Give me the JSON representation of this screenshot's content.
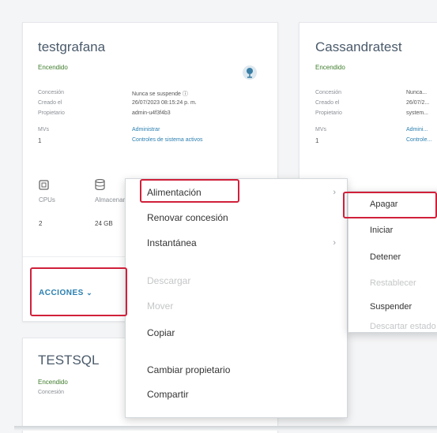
{
  "cards": {
    "testgrafana": {
      "title": "testgrafana",
      "status": "Encendido",
      "meta": [
        {
          "label": "Concesión",
          "value": "Nunca se suspende ⓘ"
        },
        {
          "label": "Creado el",
          "value": "26/07/2023 08:15:24 p. m."
        },
        {
          "label": "Propietario",
          "value": "admin-u4f3f4b3"
        },
        {
          "label": "MVs",
          "value": "Administrar"
        },
        {
          "label": "1",
          "value": "Controles de sistema activos"
        }
      ],
      "stats": [
        {
          "label": "CPUs",
          "value": "2"
        },
        {
          "label": "Almacenamiento",
          "value": "24 GB"
        }
      ],
      "actions_label": "ACCIONES"
    },
    "cassandratest": {
      "title": "Cassandratest",
      "status": "Encendido",
      "meta": [
        {
          "label": "Concesión",
          "value": "Nunca..."
        },
        {
          "label": "Creado el",
          "value": "26/07/2..."
        },
        {
          "label": "Propietario",
          "value": "system..."
        },
        {
          "label": "MVs",
          "value": "Admini..."
        },
        {
          "label": "1",
          "value": "Controle..."
        }
      ]
    },
    "testsql": {
      "title": "TESTSQL",
      "status": "Encendido",
      "meta_label": "Concesión"
    }
  },
  "context_menu": {
    "items": [
      {
        "label": "Alimentación",
        "state": "active",
        "submenu": true
      },
      {
        "label": "Renovar concesión",
        "state": "normal",
        "submenu": false
      },
      {
        "label": "Instantánea",
        "state": "normal",
        "submenu": true
      },
      {
        "label": "Descargar",
        "state": "disabled",
        "submenu": false
      },
      {
        "label": "Mover",
        "state": "disabled",
        "submenu": false
      },
      {
        "label": "Copiar",
        "state": "normal",
        "submenu": false
      },
      {
        "label": "Cambiar propietario",
        "state": "normal",
        "submenu": false
      },
      {
        "label": "Compartir",
        "state": "normal",
        "submenu": false
      }
    ]
  },
  "power_submenu": {
    "items": [
      {
        "label": "Apagar",
        "state": "active"
      },
      {
        "label": "Iniciar",
        "state": "normal"
      },
      {
        "label": "Detener",
        "state": "normal"
      },
      {
        "label": "Restablecer",
        "state": "disabled"
      },
      {
        "label": "Suspender",
        "state": "normal"
      },
      {
        "label": "Descartar estado",
        "state": "disabled"
      }
    ]
  },
  "colors": {
    "highlight": "#d0203a",
    "link": "#2a7fb0",
    "status_on": "#3f7d2c",
    "menu_active": "#e3ecf4"
  }
}
